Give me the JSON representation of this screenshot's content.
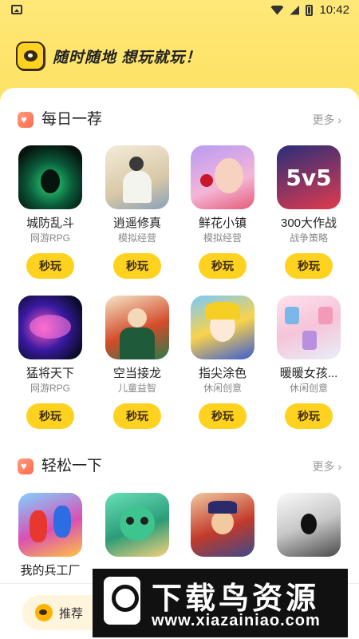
{
  "status_bar": {
    "time": "10:42"
  },
  "banner": {
    "slogan": "随时随地 想玩就玩！"
  },
  "daily": {
    "title": "每日一荐",
    "more": "更多 ›",
    "games": [
      {
        "name": "城防乱斗",
        "category": "网游RPG",
        "play": "秒玩"
      },
      {
        "name": "逍遥修真",
        "category": "模拟经营",
        "play": "秒玩"
      },
      {
        "name": "鲜花小镇",
        "category": "模拟经营",
        "play": "秒玩"
      },
      {
        "name": "300大作战",
        "category": "战争策略",
        "play": "秒玩",
        "icon_text": "5v5"
      },
      {
        "name": "猛将天下",
        "category": "网游RPG",
        "play": "秒玩"
      },
      {
        "name": "空当接龙",
        "category": "儿童益智",
        "play": "秒玩"
      },
      {
        "name": "指尖涂色",
        "category": "休闲创意",
        "play": "秒玩"
      },
      {
        "name": "暖暖女孩...",
        "category": "休闲创意",
        "play": "秒玩"
      }
    ]
  },
  "relax": {
    "title": "轻松一下",
    "more": "更多 ›",
    "games": [
      {
        "name": "我的兵工厂"
      },
      {
        "name": ""
      },
      {
        "name": ""
      },
      {
        "name": ""
      }
    ]
  },
  "bottom_nav": {
    "recommend": "推荐"
  },
  "watermark": {
    "title": "下载鸟资源",
    "url": "www.xiazainiao.com"
  }
}
